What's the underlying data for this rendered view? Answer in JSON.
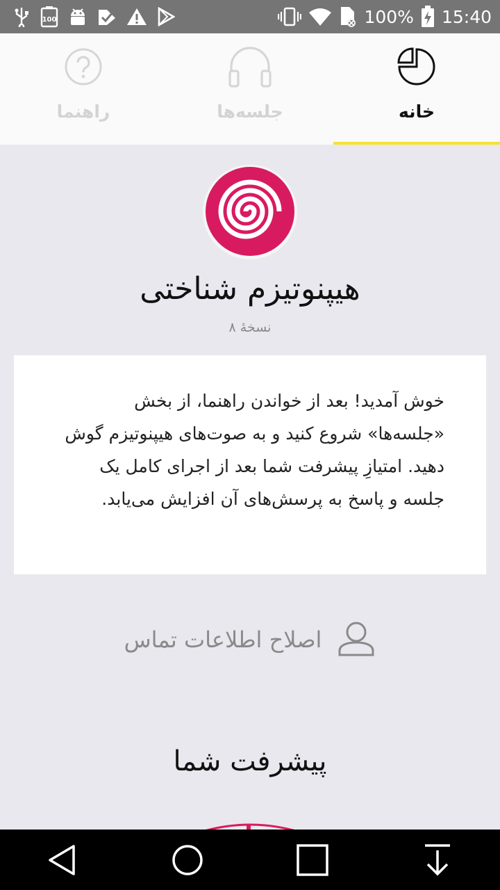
{
  "status_bar": {
    "battery_percent": "100%",
    "time": "15:40",
    "left_icons": [
      "usb-icon",
      "battery-100-icon",
      "android-icon",
      "check-icon",
      "warning-icon",
      "play-store-icon"
    ],
    "right_icons": [
      "vibrate-icon",
      "wifi-icon",
      "no-sim-icon",
      "battery-charging-icon"
    ]
  },
  "tabs": [
    {
      "id": "guide",
      "label": "راهنما",
      "icon": "question-icon",
      "active": false
    },
    {
      "id": "sessions",
      "label": "جلسه‌ها",
      "icon": "headphones-icon",
      "active": false
    },
    {
      "id": "home",
      "label": "خانه",
      "icon": "pie-chart-icon",
      "active": true
    }
  ],
  "app": {
    "title": "هیپنوتیزم شناختی",
    "version": "نسخهٔ ۸",
    "logo": "spiral-logo"
  },
  "welcome": {
    "text": "خوش آمدید! بعد از خواندن راهنما، از بخش «جلسه‌ها» شروع کنید و به صوت‌های هیپنوتیزم گوش دهید. امتیازِ پیشرفت شما بعد از اجرای کامل یک جلسه و پاسخ به پرسش‌های آن افزایش می‌یابد."
  },
  "contact": {
    "label": "اصلاح اطلاعات تماس",
    "icon": "user-icon"
  },
  "progress": {
    "title": "پیشرفت شما"
  },
  "nav": [
    "back-icon",
    "home-circle-icon",
    "recents-icon",
    "download-icon"
  ],
  "colors": {
    "accent": "#f4e232",
    "brand": "#d81b60",
    "status_bar": "#757575"
  }
}
